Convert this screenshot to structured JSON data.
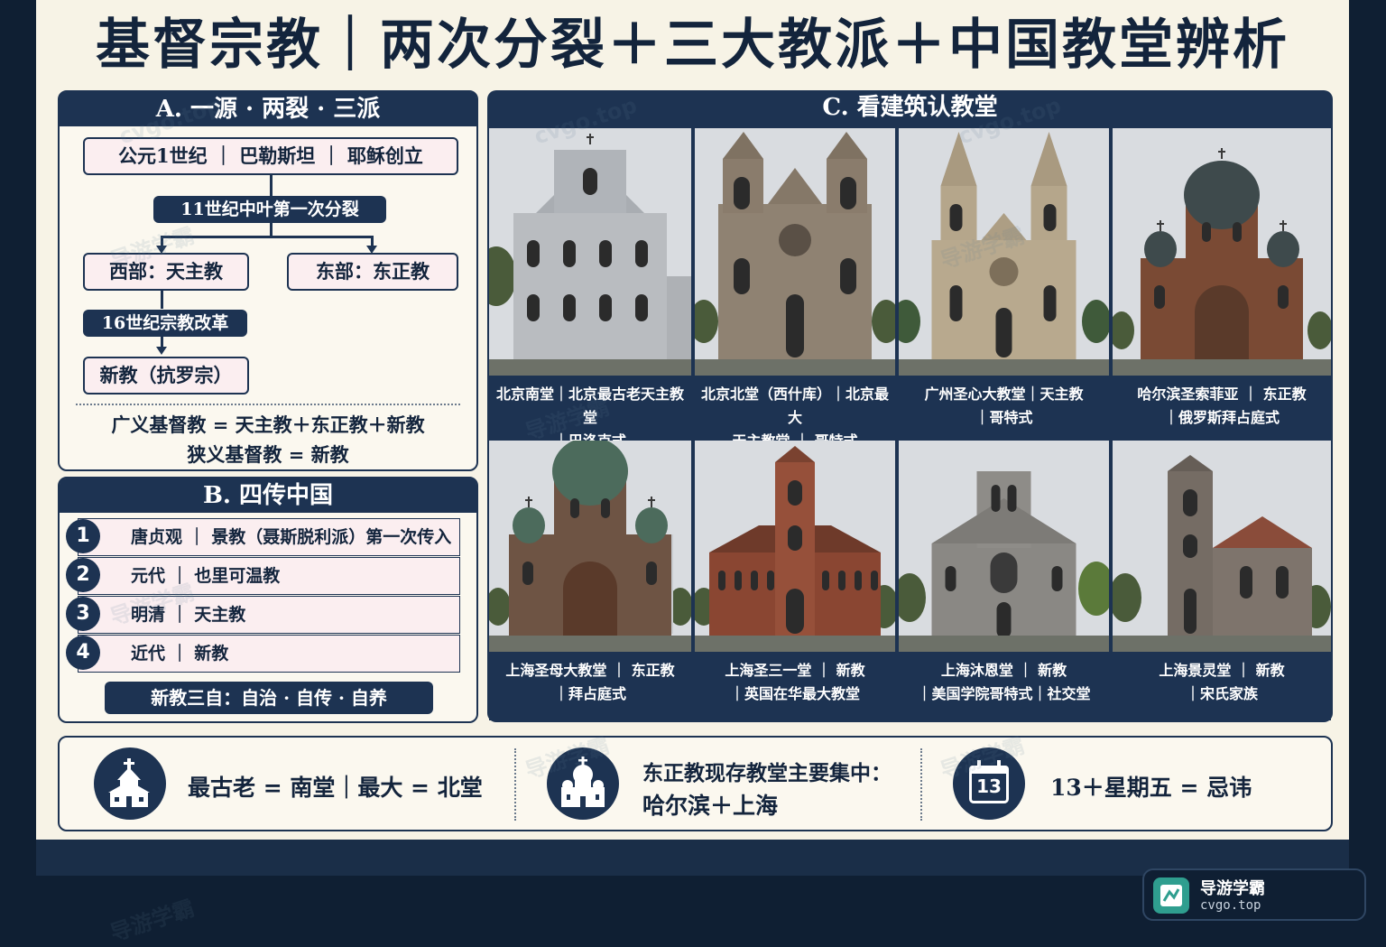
{
  "title": "基督宗教｜两次分裂＋三大教派＋中国教堂辨析",
  "panel_a": {
    "heading": "A. 一源 · 两裂 · 三派",
    "origin": "公元1世纪 ｜ 巴勒斯坦 ｜ 耶稣创立",
    "split1": "11世纪中叶第一次分裂",
    "west": "西部：天主教",
    "east": "东部：东正教",
    "reform": "16世纪宗教改革",
    "protestant": "新教（抗罗宗）",
    "broad": "广义基督教 = 天主教＋东正教＋新教",
    "narrow": "狭义基督教 = 新教"
  },
  "panel_b": {
    "heading": "B. 四传中国",
    "rows": [
      {
        "num": "1",
        "text": "唐贞观 ｜ 景教（聂斯脱利派）第一次传入"
      },
      {
        "num": "2",
        "text": "元代 ｜ 也里可温教"
      },
      {
        "num": "3",
        "text": "明清 ｜ 天主教"
      },
      {
        "num": "4",
        "text": "近代 ｜ 新教"
      }
    ],
    "three_self": "新教三自：自治 · 自传 · 自养"
  },
  "panel_c": {
    "heading": "C. 看建筑认教堂",
    "churches": [
      {
        "line1": "北京南堂｜北京最古老天主教堂",
        "line2": "｜巴洛克式",
        "style": "baroque"
      },
      {
        "line1": "北京北堂（西什库）｜北京最大",
        "line2": "天主教堂 ｜ 哥特式",
        "style": "gothic-twin"
      },
      {
        "line1": "广州圣心大教堂｜天主教",
        "line2": "｜哥特式",
        "style": "gothic-spire"
      },
      {
        "line1": "哈尔滨圣索菲亚 ｜ 东正教",
        "line2": "｜俄罗斯拜占庭式",
        "style": "byzantine"
      },
      {
        "line1": "上海圣母大教堂 ｜ 东正教",
        "line2": "｜拜占庭式",
        "style": "byzantine-green"
      },
      {
        "line1": "上海圣三一堂 ｜ 新教",
        "line2": "｜英国在华最大教堂",
        "style": "brick-tower"
      },
      {
        "line1": "上海沐恩堂 ｜ 新教",
        "line2": "｜美国学院哥特式｜社交堂",
        "style": "stone-gothic"
      },
      {
        "line1": "上海景灵堂 ｜ 新教",
        "line2": "｜宋氏家族",
        "style": "stone-tower"
      }
    ]
  },
  "facts": {
    "fact1": "最古老 = 南堂｜最大 = 北堂",
    "fact2_line1": "东正教现存教堂主要集中：",
    "fact2_line2": "哈尔滨＋上海",
    "calendar_num": "13",
    "fact3": "13＋星期五 = 忌讳"
  },
  "badge": {
    "name": "导游学霸",
    "url": "cvgo.top"
  },
  "watermark": {
    "text": "导游学霸",
    "url": "cvgo.top"
  },
  "colors": {
    "navy": "#1d3352",
    "paper": "#f7f3e6",
    "pink": "#fbeef0"
  }
}
